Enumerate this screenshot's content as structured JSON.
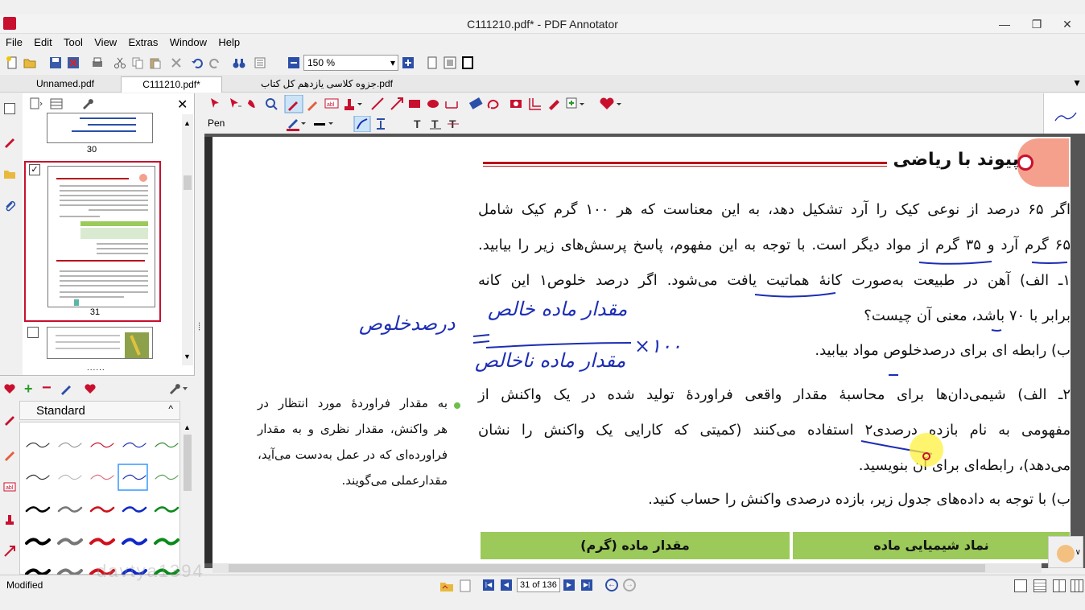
{
  "window": {
    "title": "C111210.pdf* - PDF Annotator"
  },
  "menu": [
    "File",
    "Edit",
    "Tool",
    "View",
    "Extras",
    "Window",
    "Help"
  ],
  "toolbar": {
    "zoom": "150 %"
  },
  "tabs": [
    {
      "label": "Unnamed.pdf"
    },
    {
      "label": "C111210.pdf*"
    },
    {
      "label": "جزوه کلاسی یازدهم کل کتاب.pdf"
    }
  ],
  "annotation_toolbar": {
    "tool_label": "Pen"
  },
  "thumbnails": {
    "pages": [
      "30",
      "31"
    ]
  },
  "toolbox": {
    "category": "Standard"
  },
  "page": {
    "heading": "پیوند با ریاضی",
    "lines": [
      "اگر ۶۵ درصد از نوعی کیک را آرد تشکیل دهد، به این معناست که هر ۱۰۰ گرم کیک شامل",
      "۶۵ گرم آرد و ۳۵ گرم از مواد دیگر است. با توجه به این مفهوم، پاسخ پرسش‌های زیر را بیابید.",
      "۱ـ الف) آهن در طبیعت به‌صورت کانهٔ هماتیت یافت می‌شود. اگر درصد خلوص۱ این کانه",
      "برابر با ۷۰ باشد، معنی آن چیست؟",
      "ب) رابطه ای برای درصدخلوص مواد بیابید.",
      "۲ـ الف) شیمی‌دان‌ها برای محاسبهٔ مقدار واقعی فراوردهٔ تولید شده در یک واکنش از",
      "مفهومی به نام بازده درصدی۲ استفاده می‌کنند (کمیتی که کارایی یک واکنش را نشان",
      "می‌دهد)، رابطه‌ای برای آن بنویسید.",
      "ب) با توجه به داده‌های جدول زیر، بازده درصدی واکنش را حساب کنید."
    ],
    "side_note": [
      "به مقدار فراوردهٔ مورد انتظار در",
      "هر واکنش، مقدار نظری و به مقدار",
      "فراورده‌ای که در عمل به‌دست می‌آید،",
      "مقدارعملی می‌گویند."
    ],
    "handwriting": {
      "lhs": "درصدخلوص",
      "numerator": "مقدار ماده خالص",
      "denominator": "مقدار ماده ناخالص",
      "times": "×۱۰۰"
    },
    "table_headers": [
      "نماد شیمیایی ماده",
      "مقدار ماده (گرم)"
    ]
  },
  "statusbar": {
    "status": "Modified",
    "page_indicator": "31 of 136",
    "watermark": "davtya1394"
  },
  "colors": {
    "accent_red": "#b8121b",
    "table_green": "#9bc95a",
    "ink_blue": "#1c2db5"
  }
}
